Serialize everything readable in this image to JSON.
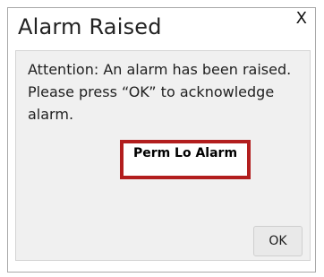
{
  "dialog": {
    "title": "Alarm Raised",
    "close_label": "X",
    "message": "Attention: An alarm has been raised. Please press “OK” to acknowledge alarm.",
    "alarm_name": "Perm Lo Alarm",
    "ok_label": "OK"
  },
  "colors": {
    "alarm_border": "#b21e1e",
    "panel_background": "#f0f0f0"
  }
}
